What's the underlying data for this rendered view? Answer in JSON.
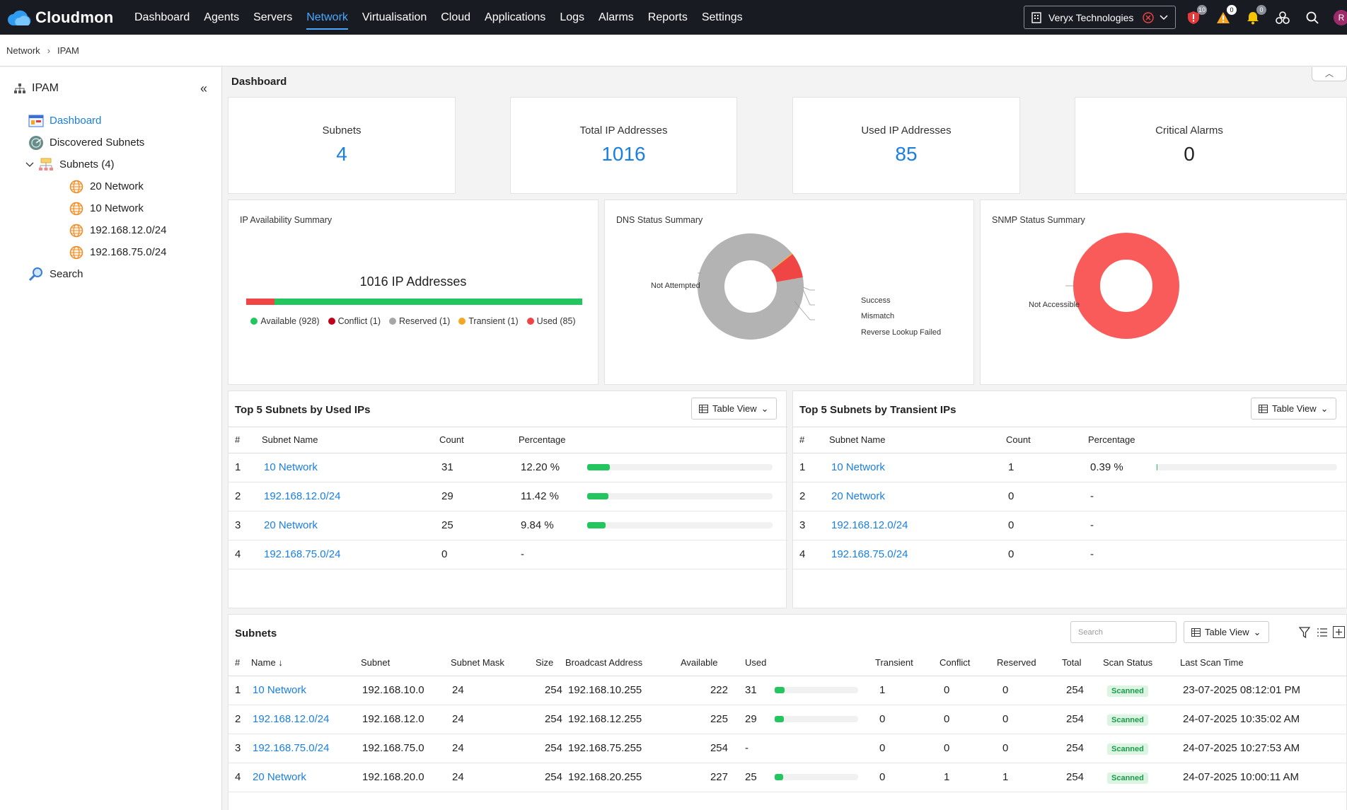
{
  "app": {
    "name": "Cloudmon"
  },
  "nav": [
    "Dashboard",
    "Agents",
    "Servers",
    "Network",
    "Virtualisation",
    "Cloud",
    "Applications",
    "Logs",
    "Alarms",
    "Reports",
    "Settings"
  ],
  "nav_active": "Network",
  "tenant": {
    "name": "Veryx Technologies"
  },
  "top_badges": {
    "security": "10",
    "warnings": "0",
    "notifications": "0"
  },
  "user_initial": "R",
  "breadcrumb": {
    "parent": "Network",
    "current": "IPAM"
  },
  "sidebar": {
    "title": "IPAM",
    "items": {
      "dashboard": "Dashboard",
      "discovered": "Discovered Subnets",
      "subnets": "Subnets (4)",
      "sub1": "20 Network",
      "sub2": "10 Network",
      "sub3": "192.168.12.0/24",
      "sub4": "192.168.75.0/24",
      "search": "Search"
    }
  },
  "dashboard": {
    "title": "Dashboard",
    "stats": {
      "subnets": {
        "label": "Subnets",
        "value": "4"
      },
      "total": {
        "label": "Total IP Addresses",
        "value": "1016"
      },
      "used": {
        "label": "Used IP Addresses",
        "value": "85"
      },
      "critical": {
        "label": "Critical Alarms",
        "value": "0"
      }
    },
    "ip_availability": {
      "title": "IP Availability Summary",
      "headline": "1016 IP Addresses",
      "used_fraction": 0.084,
      "legend": {
        "available": "Available (928)",
        "conflict": "Conflict (1)",
        "reserved": "Reserved (1)",
        "transient": "Transient (1)",
        "used": "Used (85)"
      },
      "colors": {
        "available": "#22c55e",
        "conflict": "#c0001a",
        "reserved": "#a6a6a6",
        "transient": "#f5a623",
        "used": "#f04545"
      }
    },
    "dns": {
      "title": "DNS Status Summary",
      "labels": {
        "not_attempted": "Not Attempted",
        "success": "Success",
        "mismatch": "Mismatch",
        "reverse": "Reverse Lookup Failed"
      }
    },
    "snmp": {
      "title": "SNMP Status Summary",
      "labels": {
        "not_accessible": "Not Accessible"
      }
    }
  },
  "chart_data": [
    {
      "type": "pie",
      "title": "DNS Status Summary",
      "categories": [
        "Not Attempted",
        "Success",
        "Mismatch",
        "Reverse Lookup Failed"
      ],
      "values": [
        92,
        0.3,
        0,
        7.7
      ],
      "colors": [
        "#b3b3b3",
        "#f5a623",
        "#999999",
        "#f04545"
      ]
    },
    {
      "type": "pie",
      "title": "SNMP Status Summary",
      "categories": [
        "Not Accessible"
      ],
      "values": [
        100
      ],
      "colors": [
        "#f95a5a"
      ]
    }
  ],
  "top_used": {
    "title": "Top 5 Subnets by Used IPs",
    "view": "Table View",
    "headers": {
      "n": "#",
      "name": "Subnet Name",
      "count": "Count",
      "pct": "Percentage"
    },
    "rows": [
      {
        "n": "1",
        "name": "10 Network",
        "count": "31",
        "pct": "12.20 %",
        "frac": 0.122
      },
      {
        "n": "2",
        "name": "192.168.12.0/24",
        "count": "29",
        "pct": "11.42 %",
        "frac": 0.1142
      },
      {
        "n": "3",
        "name": "20 Network",
        "count": "25",
        "pct": "9.84 %",
        "frac": 0.0984
      },
      {
        "n": "4",
        "name": "192.168.75.0/24",
        "count": "0",
        "pct": "-",
        "frac": 0
      }
    ]
  },
  "top_transient": {
    "title": "Top 5 Subnets by Transient IPs",
    "view": "Table View",
    "headers": {
      "n": "#",
      "name": "Subnet Name",
      "count": "Count",
      "pct": "Percentage"
    },
    "rows": [
      {
        "n": "1",
        "name": "10 Network",
        "count": "1",
        "pct": "0.39 %",
        "frac": 0.0039
      },
      {
        "n": "2",
        "name": "20 Network",
        "count": "0",
        "pct": "-",
        "frac": 0
      },
      {
        "n": "3",
        "name": "192.168.12.0/24",
        "count": "0",
        "pct": "-",
        "frac": 0
      },
      {
        "n": "4",
        "name": "192.168.75.0/24",
        "count": "0",
        "pct": "-",
        "frac": 0
      }
    ]
  },
  "subnets_table": {
    "title": "Subnets",
    "search_placeholder": "Search",
    "view": "Table View",
    "headers": {
      "n": "#",
      "name": "Name",
      "subnet": "Subnet",
      "mask": "Subnet Mask",
      "size": "Size",
      "broadcast": "Broadcast Address",
      "available": "Available",
      "used": "Used",
      "transient": "Transient",
      "conflict": "Conflict",
      "reserved": "Reserved",
      "total": "Total",
      "scan": "Scan Status",
      "last": "Last Scan Time"
    },
    "rows": [
      {
        "n": "1",
        "name": "10 Network",
        "subnet": "192.168.10.0",
        "mask": "24",
        "size": "254",
        "broadcast": "192.168.10.255",
        "available": "222",
        "used": "31",
        "used_frac": 0.122,
        "transient": "1",
        "conflict": "0",
        "reserved": "0",
        "total": "254",
        "scan": "Scanned",
        "last": "23-07-2025 08:12:01 PM"
      },
      {
        "n": "2",
        "name": "192.168.12.0/24",
        "subnet": "192.168.12.0",
        "mask": "24",
        "size": "254",
        "broadcast": "192.168.12.255",
        "available": "225",
        "used": "29",
        "used_frac": 0.1142,
        "transient": "0",
        "conflict": "0",
        "reserved": "0",
        "total": "254",
        "scan": "Scanned",
        "last": "24-07-2025 10:35:02 AM"
      },
      {
        "n": "3",
        "name": "192.168.75.0/24",
        "subnet": "192.168.75.0",
        "mask": "24",
        "size": "254",
        "broadcast": "192.168.75.255",
        "available": "254",
        "used": "-",
        "used_frac": 0,
        "transient": "0",
        "conflict": "0",
        "reserved": "0",
        "total": "254",
        "scan": "Scanned",
        "last": "24-07-2025 10:27:53 AM"
      },
      {
        "n": "4",
        "name": "20 Network",
        "subnet": "192.168.20.0",
        "mask": "24",
        "size": "254",
        "broadcast": "192.168.20.255",
        "available": "227",
        "used": "25",
        "used_frac": 0.0984,
        "transient": "0",
        "conflict": "1",
        "reserved": "1",
        "total": "254",
        "scan": "Scanned",
        "last": "24-07-2025 10:00:11 AM"
      }
    ]
  }
}
